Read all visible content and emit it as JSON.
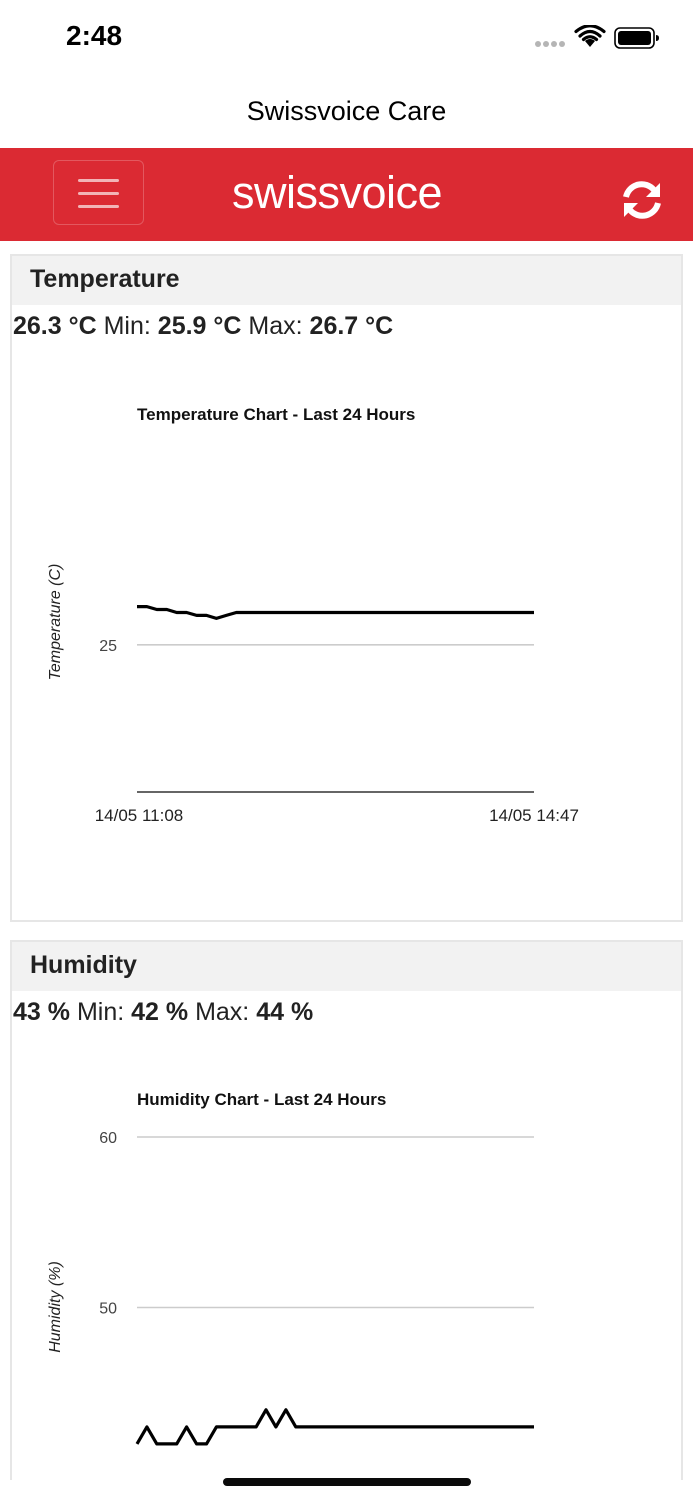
{
  "status_bar": {
    "time": "2:48",
    "icons": [
      "signal-icon",
      "wifi-icon",
      "battery-icon"
    ]
  },
  "nav": {
    "title": "Swissvoice Care"
  },
  "brand": {
    "logo_text": "swissvoice",
    "color": "#db2a33",
    "menu_icon": "hamburger-menu-icon",
    "refresh_icon": "refresh-icon"
  },
  "temperature": {
    "title": "Temperature",
    "current": "26.3 °C",
    "min_label": "Min:",
    "min": "25.9 °C",
    "max_label": "Max:",
    "max": "26.7 °C"
  },
  "humidity": {
    "title": "Humidity",
    "current": "43 %",
    "min_label": "Min:",
    "min": "42 %",
    "max_label": "Max:",
    "max": "44 %"
  },
  "chart_data": [
    {
      "type": "line",
      "title": "Temperature Chart - Last 24 Hours",
      "ylabel": "Temperature (C)",
      "xlabel": "",
      "ylim": [
        20,
        27
      ],
      "yticks": [
        25
      ],
      "xticklabels": [
        "14/05 11:08",
        "14/05 14:47"
      ],
      "grid": true,
      "series": [
        {
          "values": [
            26.3,
            26.3,
            26.2,
            26.2,
            26.1,
            26.1,
            26.0,
            26.0,
            25.9,
            26.0,
            26.1,
            26.1,
            26.1,
            26.1,
            26.1,
            26.1,
            26.1,
            26.1,
            26.1,
            26.1,
            26.1,
            26.1,
            26.1,
            26.1,
            26.1,
            26.1,
            26.1,
            26.1,
            26.1,
            26.1,
            26.1,
            26.1,
            26.1,
            26.1,
            26.1,
            26.1,
            26.1,
            26.1,
            26.1,
            26.1,
            26.1
          ]
        }
      ]
    },
    {
      "type": "line",
      "title": "Humidity Chart - Last 24 Hours",
      "ylabel": "Humidity (%)",
      "xlabel": "",
      "ylim": [
        40,
        60
      ],
      "yticks": [
        60,
        50
      ],
      "grid": true,
      "series": [
        {
          "values": [
            42,
            43,
            42,
            42,
            42,
            43,
            42,
            42,
            43,
            43,
            43,
            43,
            43,
            44,
            43,
            44,
            43,
            43,
            43,
            43,
            43,
            43,
            43,
            43,
            43,
            43,
            43,
            43,
            43,
            43,
            43,
            43,
            43,
            43,
            43,
            43,
            43,
            43,
            43,
            43,
            43
          ]
        }
      ]
    }
  ]
}
